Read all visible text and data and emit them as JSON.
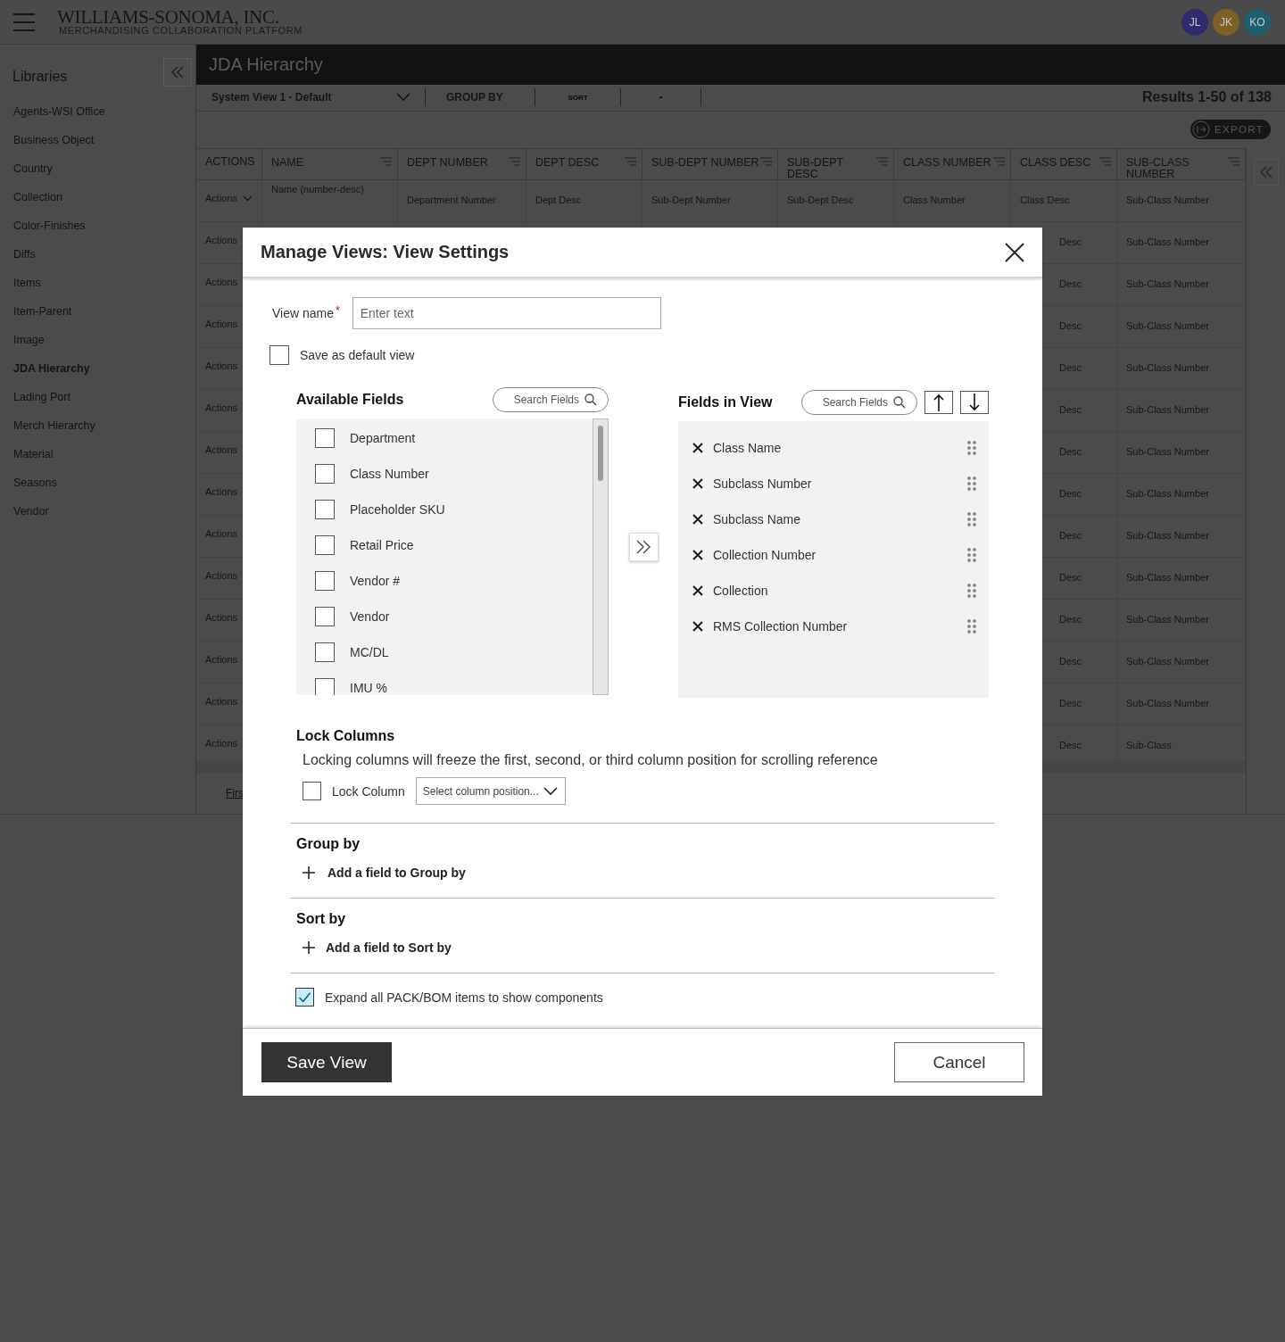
{
  "header": {
    "logo_title": "WILLIAMS-SONOMA, INC.",
    "logo_subtitle": "MERCHANDISING COLLABORATION PLATFORM",
    "avatars": [
      {
        "initials": "JL",
        "color": "#2f2b6e"
      },
      {
        "initials": "JK",
        "color": "#7d6124"
      },
      {
        "initials": "KO",
        "color": "#1d5f6e"
      }
    ]
  },
  "sidebar": {
    "title": "Libraries",
    "items": [
      {
        "label": "Agents-WSI Office",
        "selected": false
      },
      {
        "label": "Business Object",
        "selected": false
      },
      {
        "label": "Country",
        "selected": false
      },
      {
        "label": "Collection",
        "selected": false
      },
      {
        "label": "Color-Finishes",
        "selected": false
      },
      {
        "label": "Diffs",
        "selected": false
      },
      {
        "label": "Items",
        "selected": false
      },
      {
        "label": "Item-Parent",
        "selected": false
      },
      {
        "label": "Image",
        "selected": false
      },
      {
        "label": "JDA Hierarchy",
        "selected": true
      },
      {
        "label": "Lading Port",
        "selected": false
      },
      {
        "label": "Merch Hierarchy",
        "selected": false
      },
      {
        "label": "Material",
        "selected": false
      },
      {
        "label": "Seasons",
        "selected": false
      },
      {
        "label": "Vendor",
        "selected": false
      }
    ]
  },
  "page": {
    "title": "JDA Hierarchy",
    "view_select": "System View 1 - Default",
    "group_by": "GROUP BY",
    "sort": "SORT",
    "toolbar_item_4": "-",
    "results": "Results 1-50 of 138",
    "export": "EXPORT"
  },
  "table": {
    "columns": [
      "ACTIONS",
      "NAME",
      "DEPT NUMBER",
      "DEPT DESC",
      "SUB-DEPT NUMBER",
      "SUB-DEPT DESC",
      "CLASS NUMBER",
      "CLASS DESC",
      "SUB-CLASS NUMBER"
    ],
    "first_row": [
      "Actions",
      "Name (number-desc)",
      "Department Number",
      "Dept Desc",
      "Sub-Dept Number",
      "Sub-Dept Desc",
      "Class Number",
      "Class Desc",
      "Sub-Class Number"
    ],
    "rows": [
      {
        "actions": "Actions",
        "class_desc": "Desc",
        "sub_class": "Sub-Class Number"
      },
      {
        "actions": "Actions",
        "class_desc": "Desc",
        "sub_class": "Sub-Class Number"
      },
      {
        "actions": "Actions",
        "class_desc": "Desc",
        "sub_class": "Sub-Class Number"
      },
      {
        "actions": "Actions",
        "class_desc": "Desc",
        "sub_class": "Sub-Class Number"
      },
      {
        "actions": "Actions",
        "class_desc": "Desc",
        "sub_class": "Sub-Class Number"
      },
      {
        "actions": "Actions",
        "class_desc": "Desc",
        "sub_class": "Sub-Class Number"
      },
      {
        "actions": "Actions",
        "class_desc": "Desc",
        "sub_class": "Sub-Class Number"
      },
      {
        "actions": "Actions",
        "class_desc": "Desc",
        "sub_class": "Sub-Class Number"
      },
      {
        "actions": "Actions",
        "class_desc": "Desc",
        "sub_class": "Sub-Class Number"
      },
      {
        "actions": "Actions",
        "class_desc": "Desc",
        "sub_class": "Sub-Class Number"
      },
      {
        "actions": "Actions",
        "class_desc": "Desc",
        "sub_class": "Sub-Class Number"
      },
      {
        "actions": "Actions",
        "class_desc": "Desc",
        "sub_class": "Sub-Class Number"
      },
      {
        "actions": "Actions",
        "class_desc": "Desc",
        "sub_class": "Sub-Class"
      }
    ],
    "pagination": "Firs"
  },
  "modal": {
    "title": "Manage Views: View Settings",
    "view_name": {
      "label": "View name",
      "required_mark": "*",
      "placeholder": "Enter text"
    },
    "save_default": {
      "label": "Save as default view",
      "checked": false
    },
    "available": {
      "title": "Available Fields",
      "search_placeholder": "Search Fields",
      "items": [
        {
          "label": "Department",
          "checked": false
        },
        {
          "label": "Class Number",
          "checked": false
        },
        {
          "label": "Placeholder SKU",
          "checked": false
        },
        {
          "label": "Retail Price",
          "checked": false
        },
        {
          "label": "Vendor #",
          "checked": false
        },
        {
          "label": "Vendor",
          "checked": false
        },
        {
          "label": "MC/DL",
          "checked": false
        },
        {
          "label": "IMU %",
          "checked": false
        }
      ]
    },
    "fields_in_view": {
      "title": "Fields in View",
      "search_placeholder": "Search Fields",
      "items": [
        "Class Name",
        "Subclass Number",
        "Subclass Name",
        "Collection Number",
        "Collection",
        "RMS Collection Number"
      ]
    },
    "lock": {
      "title": "Lock Columns",
      "description": "Locking columns will freeze the first, second, or third column position for scrolling reference",
      "checkbox": {
        "label": "Lock Column",
        "checked": false
      },
      "select_placeholder": "Select column position..."
    },
    "group_by": {
      "title": "Group by",
      "action": "Add a field to Group by"
    },
    "sort_by": {
      "title": "Sort by",
      "action": "Add a field to Sort by"
    },
    "expand": {
      "label": "Expand all PACK/BOM items to show components",
      "checked": true
    },
    "buttons": {
      "save": "Save View",
      "cancel": "Cancel"
    }
  }
}
